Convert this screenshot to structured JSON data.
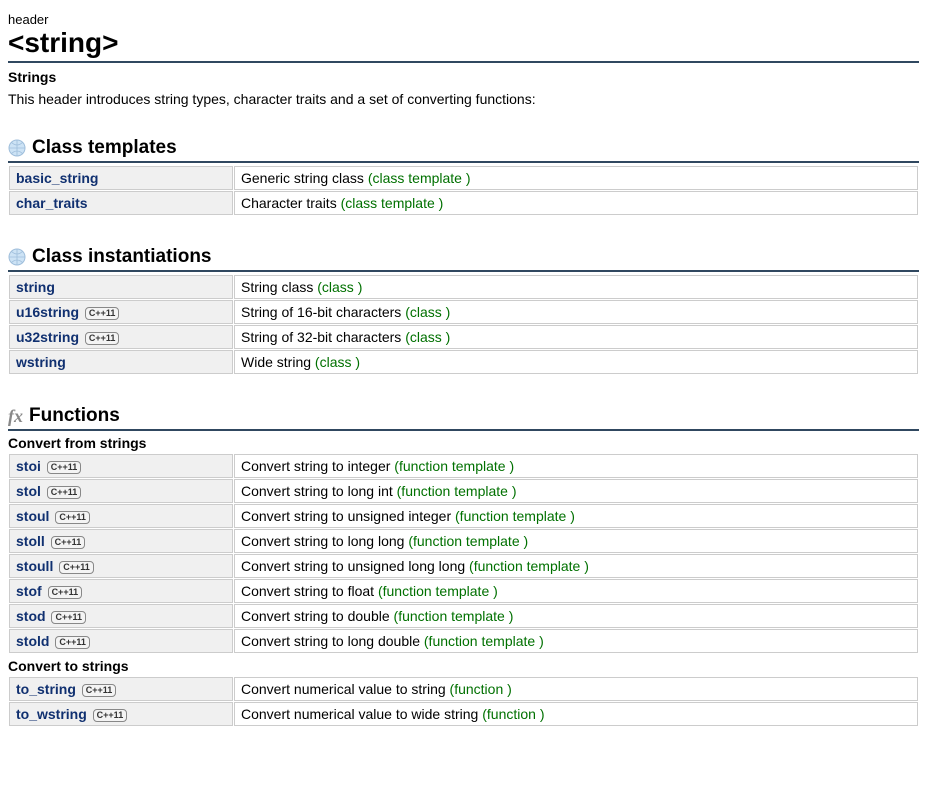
{
  "overline": "header",
  "title": "<string>",
  "subheader": "Strings",
  "intro": "This header introduces string types, character traits and a set of converting functions:",
  "badge_label": "C++11",
  "sections": {
    "class_templates": {
      "title": "Class templates",
      "rows": [
        {
          "name": "basic_string",
          "badge": false,
          "desc": "Generic string class",
          "type": "(class template )"
        },
        {
          "name": "char_traits",
          "badge": false,
          "desc": "Character traits",
          "type": "(class template )"
        }
      ]
    },
    "class_instantiations": {
      "title": "Class instantiations",
      "rows": [
        {
          "name": "string",
          "badge": false,
          "desc": "String class",
          "type": "(class )"
        },
        {
          "name": "u16string",
          "badge": true,
          "desc": "String of 16-bit characters",
          "type": "(class )"
        },
        {
          "name": "u32string",
          "badge": true,
          "desc": "String of 32-bit characters",
          "type": "(class )"
        },
        {
          "name": "wstring",
          "badge": false,
          "desc": "Wide string",
          "type": "(class )"
        }
      ]
    },
    "functions": {
      "title": "Functions",
      "subsections": [
        {
          "title": "Convert from strings",
          "rows": [
            {
              "name": "stoi",
              "badge": true,
              "desc": "Convert string to integer",
              "type": "(function template )"
            },
            {
              "name": "stol",
              "badge": true,
              "desc": "Convert string to long int",
              "type": "(function template )"
            },
            {
              "name": "stoul",
              "badge": true,
              "desc": "Convert string to unsigned integer",
              "type": "(function template )"
            },
            {
              "name": "stoll",
              "badge": true,
              "desc": "Convert string to long long",
              "type": "(function template )"
            },
            {
              "name": "stoull",
              "badge": true,
              "desc": "Convert string to unsigned long long",
              "type": "(function template )"
            },
            {
              "name": "stof",
              "badge": true,
              "desc": "Convert string to float",
              "type": "(function template )"
            },
            {
              "name": "stod",
              "badge": true,
              "desc": "Convert string to double",
              "type": "(function template )"
            },
            {
              "name": "stold",
              "badge": true,
              "desc": "Convert string to long double",
              "type": "(function template )"
            }
          ]
        },
        {
          "title": "Convert to strings",
          "rows": [
            {
              "name": "to_string",
              "badge": true,
              "desc": "Convert numerical value to string",
              "type": "(function )"
            },
            {
              "name": "to_wstring",
              "badge": true,
              "desc": "Convert numerical value to wide string",
              "type": "(function )"
            }
          ]
        }
      ]
    }
  }
}
